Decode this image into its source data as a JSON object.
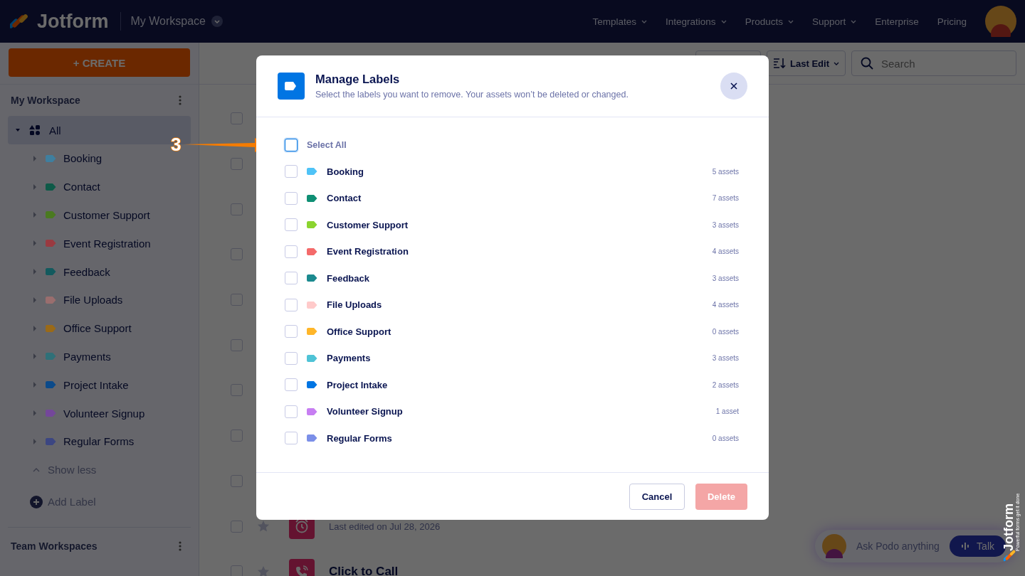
{
  "topbar": {
    "brand": "Jotform",
    "workspace": "My Workspace",
    "nav": [
      {
        "label": "Templates",
        "menu": true
      },
      {
        "label": "Integrations",
        "menu": true
      },
      {
        "label": "Products",
        "menu": true
      },
      {
        "label": "Support",
        "menu": true
      },
      {
        "label": "Enterprise",
        "menu": false
      },
      {
        "label": "Pricing",
        "menu": false
      }
    ]
  },
  "sidebar": {
    "create": "+ CREATE",
    "heading": "My Workspace",
    "all": {
      "label": "All",
      "selected": true,
      "expanded": true
    },
    "labels": [
      {
        "label": "Booking",
        "color": "#3f7f9f",
        "expanded": false
      },
      {
        "label": "Contact",
        "color": "#0e5a48",
        "expanded": false
      },
      {
        "label": "Customer Support",
        "color": "#4a7a20",
        "expanded": false
      },
      {
        "label": "Event Registration",
        "color": "#9a3a40",
        "expanded": false
      },
      {
        "label": "Feedback",
        "color": "#135a5e",
        "expanded": false
      },
      {
        "label": "File Uploads",
        "color": "#9a6e6e",
        "expanded": false
      },
      {
        "label": "Office Support",
        "color": "#9a6a18",
        "expanded": false
      },
      {
        "label": "Payments",
        "color": "#2f7078",
        "expanded": false
      },
      {
        "label": "Project Intake",
        "color": "#0b4a8a",
        "expanded": false
      },
      {
        "label": "Volunteer Signup",
        "color": "#74479a",
        "expanded": false
      },
      {
        "label": "Regular Forms",
        "color": "#3c4682",
        "expanded": false
      }
    ],
    "show_less": "Show less",
    "add_label": "Add Label",
    "team_heading": "Team Workspaces"
  },
  "toolbar": {
    "sort": "Last Edit",
    "search_placeholder": "Search"
  },
  "forms": [
    {
      "checked": false
    },
    {
      "checked": false
    },
    {
      "checked": false
    },
    {
      "checked": false
    },
    {
      "checked": false
    },
    {
      "checked": false
    },
    {
      "checked": false
    },
    {
      "checked": false
    },
    {
      "checked": false
    },
    {
      "checked": false,
      "starred": false,
      "kind": "timer",
      "subtitle": "Last edited on Jul 28, 2026"
    },
    {
      "checked": false,
      "starred": false,
      "kind": "phone",
      "title": "Click to Call"
    }
  ],
  "modal": {
    "title": "Manage Labels",
    "subtitle": "Select the labels you want to remove. Your assets won’t be deleted or changed.",
    "select_all": {
      "label": "Select All",
      "checked": false
    },
    "labels": [
      {
        "label": "Booking",
        "color": "#4fc3f7",
        "count": "5 assets",
        "checked": false
      },
      {
        "label": "Contact",
        "color": "#0f8f74",
        "count": "7 assets",
        "checked": false
      },
      {
        "label": "Customer Support",
        "color": "#8bd42f",
        "count": "3 assets",
        "checked": false
      },
      {
        "label": "Event Registration",
        "color": "#f46a6a",
        "count": "4 assets",
        "checked": false
      },
      {
        "label": "Feedback",
        "color": "#1b8a8f",
        "count": "3 assets",
        "checked": false
      },
      {
        "label": "File Uploads",
        "color": "#ffcaca",
        "count": "4 assets",
        "checked": false
      },
      {
        "label": "Office Support",
        "color": "#ffb629",
        "count": "0 assets",
        "checked": false
      },
      {
        "label": "Payments",
        "color": "#4fc3d6",
        "count": "3 assets",
        "checked": false
      },
      {
        "label": "Project Intake",
        "color": "#0075e3",
        "count": "2 assets",
        "checked": false
      },
      {
        "label": "Volunteer Signup",
        "color": "#c77ef2",
        "count": "1 asset",
        "checked": false
      },
      {
        "label": "Regular Forms",
        "color": "#7b8fe8",
        "count": "0 assets",
        "checked": false
      }
    ],
    "cancel": "Cancel",
    "delete": {
      "label": "Delete",
      "disabled": true
    }
  },
  "annotation": {
    "number": "3"
  },
  "chat": {
    "placeholder": "Ask Podo anything",
    "talk": "Talk"
  },
  "badge": {
    "brand": "Jotform",
    "tagline": "Powerful forms get it done"
  }
}
